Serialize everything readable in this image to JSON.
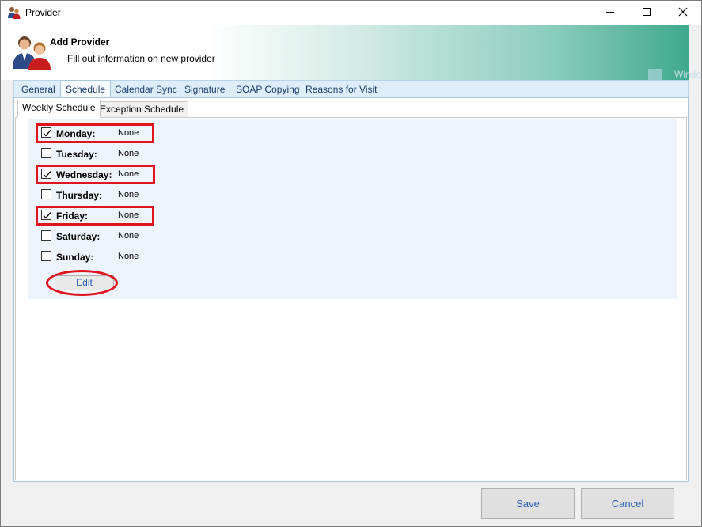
{
  "window": {
    "title": "Provider",
    "app_icon": "provider-people-icon",
    "controls": {
      "minimize": "minimize-icon",
      "maximize": "maximize-icon",
      "close": "close-icon"
    }
  },
  "header": {
    "title": "Add Provider",
    "subtitle": "Fill out information on new provider",
    "icon": "provider-people-icon",
    "watermark": "Windo"
  },
  "main_tabs": [
    {
      "label": "General",
      "active": false
    },
    {
      "label": "Schedule",
      "active": true
    },
    {
      "label": "Calendar Sync",
      "active": false
    },
    {
      "label": "Signature",
      "active": false
    },
    {
      "label": "SOAP Copying",
      "active": false
    },
    {
      "label": "Reasons for Visit",
      "active": false
    }
  ],
  "sub_tabs": [
    {
      "label": "Weekly Schedule",
      "active": true
    },
    {
      "label": "Exception Schedule",
      "active": false
    }
  ],
  "days": [
    {
      "label": "Monday:",
      "value": "None",
      "checked": true,
      "highlighted": true
    },
    {
      "label": "Tuesday:",
      "value": "None",
      "checked": false,
      "highlighted": false
    },
    {
      "label": "Wednesday:",
      "value": "None",
      "checked": true,
      "highlighted": true
    },
    {
      "label": "Thursday:",
      "value": "None",
      "checked": false,
      "highlighted": false
    },
    {
      "label": "Friday:",
      "value": "None",
      "checked": true,
      "highlighted": true
    },
    {
      "label": "Saturday:",
      "value": "None",
      "checked": false,
      "highlighted": false
    },
    {
      "label": "Sunday:",
      "value": "None",
      "checked": false,
      "highlighted": false
    }
  ],
  "edit_button": {
    "label": "Edit",
    "highlighted": true
  },
  "footer": {
    "save_label": "Save",
    "cancel_label": "Cancel"
  },
  "colors": {
    "highlight": "#e0141e",
    "button_text": "#2760b8",
    "banner_accent": "#3fa98d",
    "tabstrip": "#ddeefa"
  }
}
